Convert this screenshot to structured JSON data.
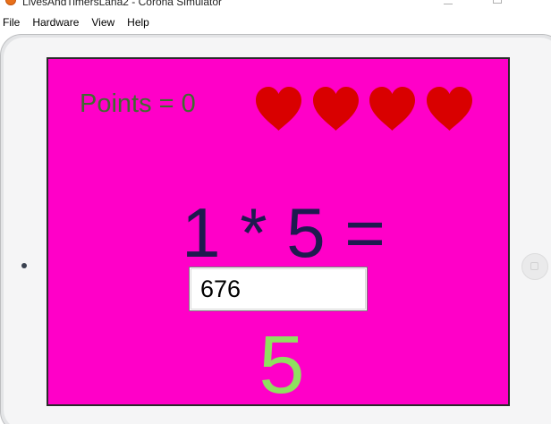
{
  "window": {
    "title": "LivesAndTimersLana2 - Corona Simulator"
  },
  "menubar": {
    "items": [
      "File",
      "Hardware",
      "View",
      "Help"
    ]
  },
  "game": {
    "points_text": "Points = 0",
    "lives": 4,
    "question": "1 * 5 =",
    "answer_value": "676",
    "feedback_number": "5",
    "colors": {
      "background": "#ff00c8",
      "points": "#3f6b2f",
      "heart": "#d90000",
      "question": "#1e1a4f",
      "feedback": "#8fe060"
    }
  }
}
